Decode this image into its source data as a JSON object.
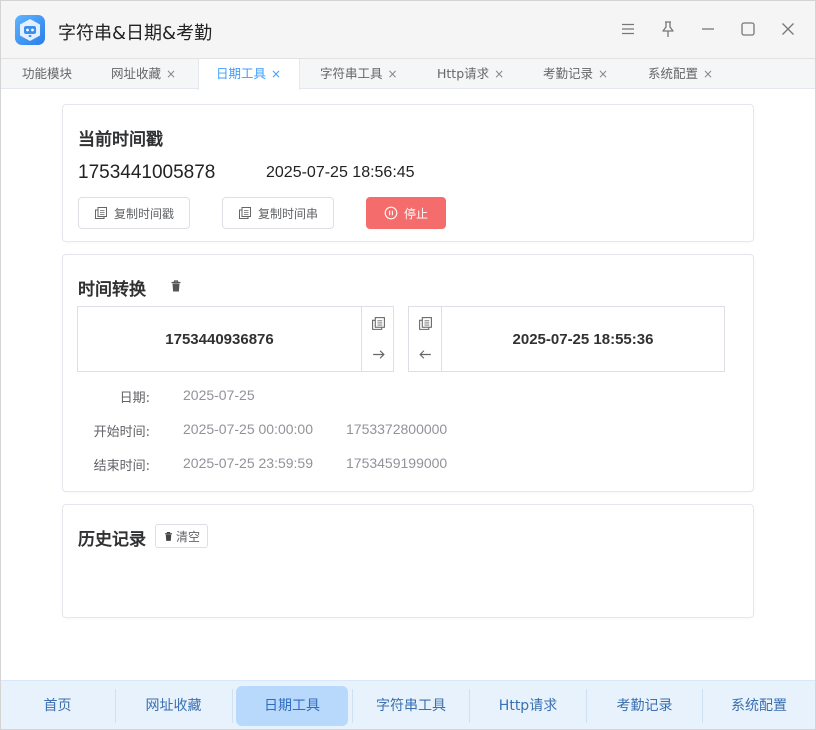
{
  "app": {
    "title": "字符串&日期&考勤",
    "logo_icon": "robot-app-icon"
  },
  "window_controls": [
    "menu-icon",
    "pin-icon",
    "minimize-icon",
    "maximize-icon",
    "close-icon"
  ],
  "tabs": [
    {
      "label": "功能模块",
      "closable": false,
      "active": false
    },
    {
      "label": "网址收藏",
      "closable": true,
      "active": false
    },
    {
      "label": "日期工具",
      "closable": true,
      "active": true
    },
    {
      "label": "字符串工具",
      "closable": true,
      "active": false
    },
    {
      "label": "Http请求",
      "closable": true,
      "active": false
    },
    {
      "label": "考勤记录",
      "closable": true,
      "active": false
    },
    {
      "label": "系统配置",
      "closable": true,
      "active": false
    }
  ],
  "tab_close_glyph": "×",
  "current": {
    "title": "当前时间戳",
    "timestamp": "1753441005878",
    "datetime": "2025-07-25 18:56:45",
    "copy_ts_label": "复制时间戳",
    "copy_str_label": "复制时间串",
    "stop_label": "停止"
  },
  "convert": {
    "title": "时间转换",
    "left_value": "1753440936876",
    "right_value": "2025-07-25 18:55:36",
    "rows": [
      {
        "label": "日期:",
        "value": "2025-07-25",
        "ts": ""
      },
      {
        "label": "开始时间:",
        "value": "2025-07-25 00:00:00",
        "ts": "1753372800000"
      },
      {
        "label": "结束时间:",
        "value": "2025-07-25 23:59:59",
        "ts": "1753459199000"
      }
    ]
  },
  "history": {
    "title": "历史记录",
    "clear_label": "清空"
  },
  "bottom_nav": [
    {
      "label": "首页",
      "active": false
    },
    {
      "label": "网址收藏",
      "active": false
    },
    {
      "label": "日期工具",
      "active": true
    },
    {
      "label": "字符串工具",
      "active": false
    },
    {
      "label": "Http请求",
      "active": false
    },
    {
      "label": "考勤记录",
      "active": false
    },
    {
      "label": "系统配置",
      "active": false
    }
  ],
  "colors": {
    "accent": "#409eff",
    "danger": "#f56c6c",
    "nav_bg": "#e8f2fc",
    "nav_active": "#b8d9fb"
  }
}
